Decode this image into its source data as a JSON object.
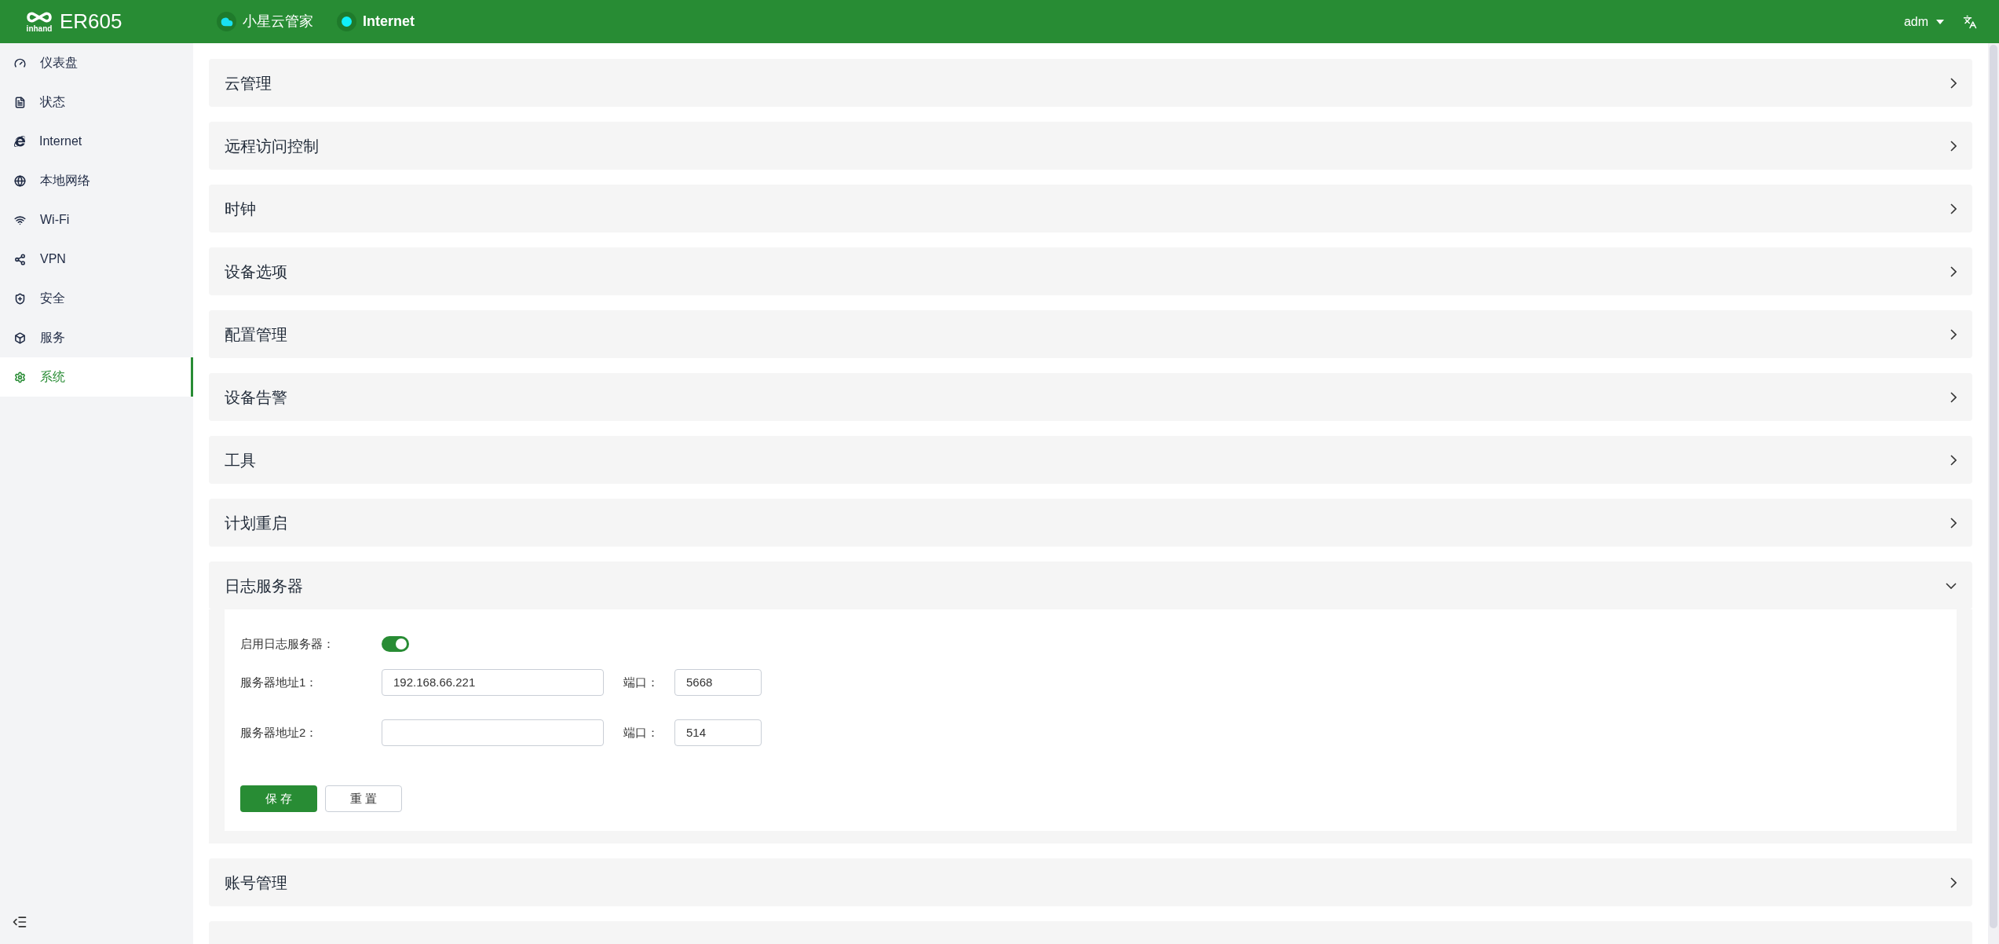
{
  "header": {
    "logo_text": "inhand",
    "product": "ER605",
    "links": [
      {
        "label": "小星云管家"
      },
      {
        "label": "Internet"
      }
    ],
    "user": "adm"
  },
  "sidebar": {
    "items": [
      {
        "label": "仪表盘",
        "selected": false
      },
      {
        "label": "状态",
        "selected": false
      },
      {
        "label": "Internet",
        "selected": false
      },
      {
        "label": "本地网络",
        "selected": false
      },
      {
        "label": "Wi-Fi",
        "selected": false
      },
      {
        "label": "VPN",
        "selected": false
      },
      {
        "label": "安全",
        "selected": false
      },
      {
        "label": "服务",
        "selected": false
      },
      {
        "label": "系统",
        "selected": true
      }
    ]
  },
  "panels": [
    {
      "title": "云管理",
      "expanded": false
    },
    {
      "title": "远程访问控制",
      "expanded": false
    },
    {
      "title": "时钟",
      "expanded": false
    },
    {
      "title": "设备选项",
      "expanded": false
    },
    {
      "title": "配置管理",
      "expanded": false
    },
    {
      "title": "设备告警",
      "expanded": false
    },
    {
      "title": "工具",
      "expanded": false
    },
    {
      "title": "计划重启",
      "expanded": false
    },
    {
      "title": "日志服务器",
      "expanded": true,
      "form": {
        "enable": {
          "label": "启用日志服务器：",
          "on": true
        },
        "servers": [
          {
            "label": "服务器地址1：",
            "value": "192.168.66.221",
            "port_label": "端口：",
            "port": "5668"
          },
          {
            "label": "服务器地址2：",
            "port_label": "端口：",
            "port": "514"
          }
        ],
        "buttons": [
          {
            "label": "保 存",
            "kind": "primary"
          },
          {
            "label": "重 置",
            "kind": "secondary"
          }
        ]
      }
    },
    {
      "title": "账号管理",
      "expanded": false
    }
  ]
}
